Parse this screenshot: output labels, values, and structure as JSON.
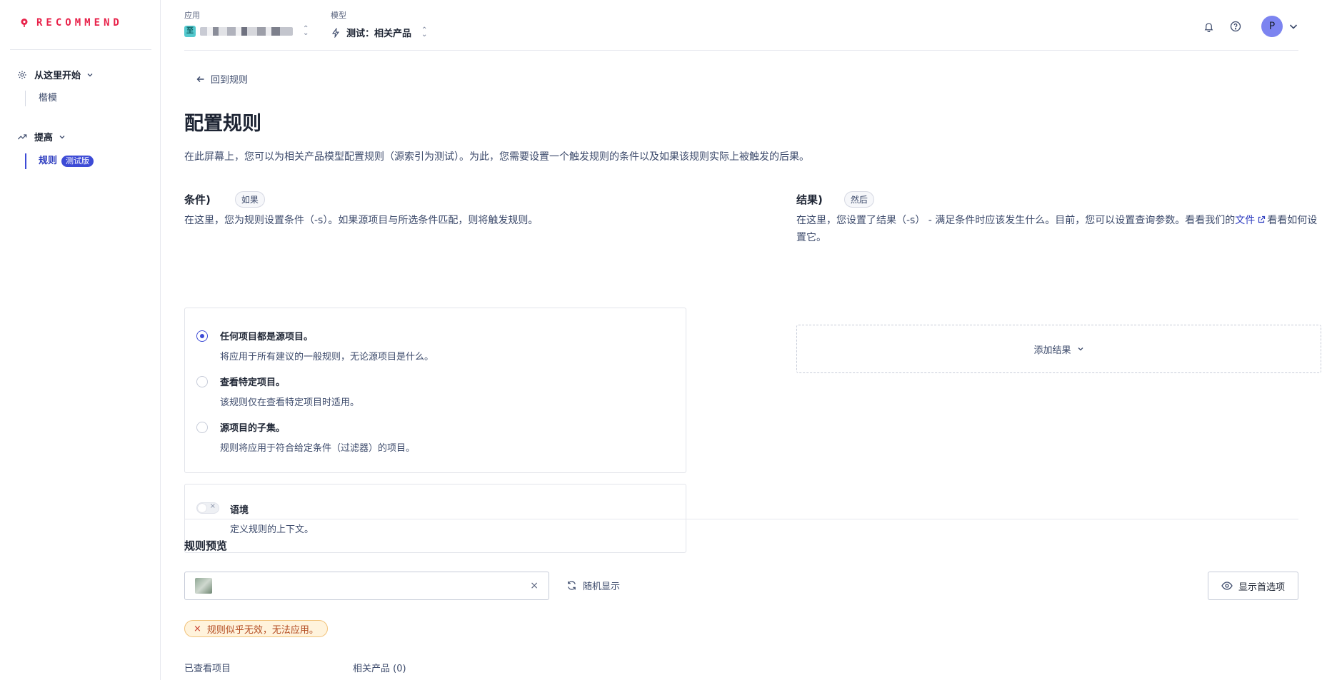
{
  "sidebar": {
    "logo_text": "RECOMMEND",
    "groups": [
      {
        "label": "从这里开始",
        "items": [
          {
            "label": "楷模"
          }
        ]
      },
      {
        "label": "提高",
        "items": [
          {
            "label": "规则",
            "badge": "测试版"
          }
        ]
      }
    ]
  },
  "topbar": {
    "app_label": "应用",
    "app_icon_text": "至",
    "model_label": "模型",
    "model_value": "测试：相关产品",
    "avatar_initial": "P"
  },
  "page": {
    "back_label": "回到规则",
    "title": "配置规则",
    "description": "在此屏幕上，您可以为相关产品模型配置规则（源索引为测试）。为此，您需要设置一个触发规则的条件以及如果该规则实际上被触发的后果。"
  },
  "conditions": {
    "title": "条件)",
    "pill": "如果",
    "description": "在这里，您为规则设置条件（-s）。如果源项目与所选条件匹配，则将触发规则。",
    "options": [
      {
        "title": "任何项目都是源项目。",
        "sub": "将应用于所有建议的一般规则，无论源项目是什么。",
        "checked": true
      },
      {
        "title": "查看特定项目。",
        "sub": "该规则仅在查看特定项目时适用。",
        "checked": false
      },
      {
        "title": "源项目的子集。",
        "sub": "规则将应用于符合给定条件（过滤器）的项目。",
        "checked": false
      }
    ],
    "context_title": "语境",
    "context_sub": "定义规则的上下文。"
  },
  "results": {
    "title": "结果)",
    "pill": "然后",
    "description_part1": "在这里，您设置了结果（-s） - 满足条件时应该发生什么。目前，您可以设置查询参数。看看我们的",
    "doc_link": "文件",
    "description_part2": "看看如何设置它。",
    "add_label": "添加结果"
  },
  "preview": {
    "title": "规则预览",
    "clear_symbol": "×",
    "random_label": "随机显示",
    "pref_label": "显示首选项",
    "error_symbol": "×",
    "error_text": "规则似乎无效，无法应用。",
    "tab_viewed": "已查看项目",
    "tab_related": "相关产品 (0)"
  },
  "colors": {
    "brand": "#e8224a",
    "accent": "#3d4bd6",
    "warning_bg": "#fff3dc"
  }
}
